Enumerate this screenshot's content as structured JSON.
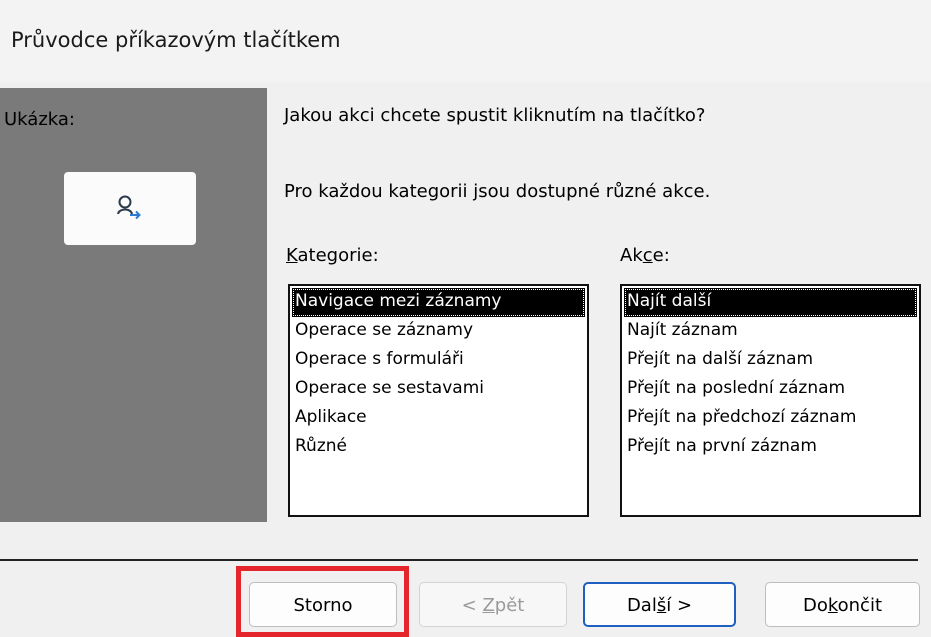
{
  "window": {
    "title": "Průvodce příkazovým tlačítkem"
  },
  "preview": {
    "label": "Ukázka:",
    "icon": "find-next-icon"
  },
  "main": {
    "question": "Jakou akci chcete spustit kliknutím na tlačítko?",
    "info": "Pro každou kategorii jsou dostupné různé akce."
  },
  "categories": {
    "label": "Kategorie:",
    "selected_index": 0,
    "items": [
      "Navigace mezi záznamy",
      "Operace se záznamy",
      "Operace s formuláři",
      "Operace se sestavami",
      "Aplikace",
      "Různé"
    ]
  },
  "actions": {
    "label": "Akce:",
    "selected_index": 0,
    "items": [
      "Najít další",
      "Najít záznam",
      "Přejít na další záznam",
      "Přejít na poslední záznam",
      "Přejít na předchozí záznam",
      "Přejít na první záznam"
    ]
  },
  "buttons": {
    "storno": "Storno",
    "zpet": "< Zpět",
    "dalsi": "Další >",
    "dokoncit": "Dokončit"
  },
  "colors": {
    "highlight": "#e4262c",
    "preview_panel": "#7a7a7a",
    "default_button_border": "#1f5fbf"
  }
}
